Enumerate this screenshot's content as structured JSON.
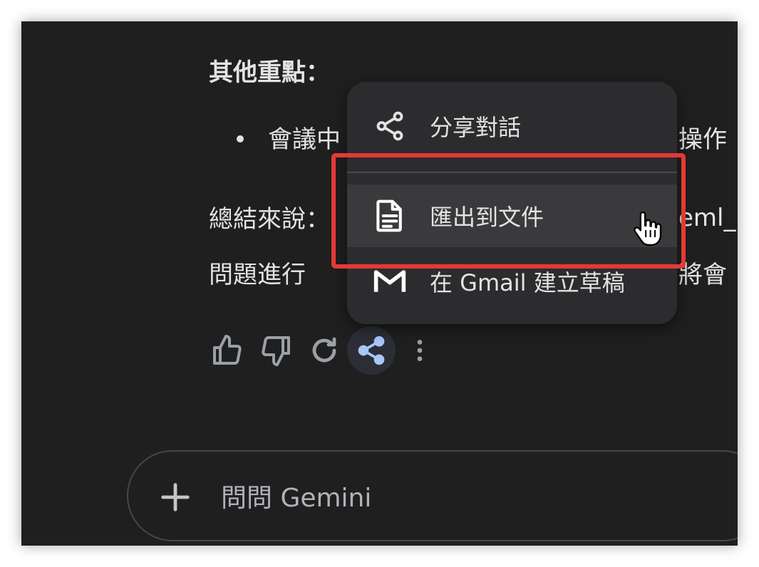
{
  "content": {
    "heading": "其他重點：",
    "bullet_text": "會議中",
    "bullet_tail": "操作",
    "summary_line1": "總結來說：",
    "summary_line1_tail": "eml_",
    "summary_line2": "問題進行",
    "summary_line2_tail": "將會"
  },
  "actions": {
    "icons": [
      "thumbs-up-icon",
      "thumbs-down-icon",
      "regenerate-icon",
      "share-icon",
      "more-vert-icon"
    ],
    "active_color": "#a8c7fa"
  },
  "share_menu": {
    "items": [
      {
        "label": "分享對話",
        "icon": "share-icon"
      },
      {
        "label": "匯出到文件",
        "icon": "docs-icon"
      },
      {
        "label": "在 Gmail 建立草稿",
        "icon": "gmail-icon"
      }
    ],
    "highlight_color": "#e53935"
  },
  "prompt": {
    "placeholder": "問問 Gemini",
    "value": ""
  }
}
